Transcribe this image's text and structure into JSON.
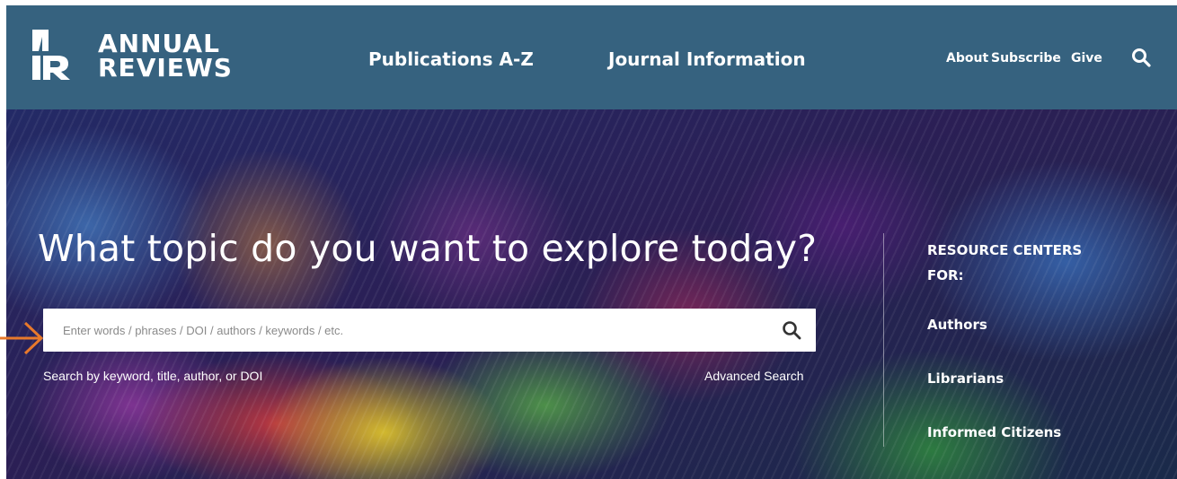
{
  "header": {
    "logo_line1": "ANNUAL",
    "logo_line2": "REVIEWS",
    "nav": {
      "publications": "Publications A-Z",
      "journal_info": "Journal Information",
      "about": "About",
      "subscribe": "Subscribe",
      "give": "Give"
    },
    "search_icon": "search-icon"
  },
  "hero": {
    "headline": "What topic do you want to explore today?",
    "search": {
      "placeholder": "Enter words / phrases / DOI / authors / keywords / etc.",
      "value": "",
      "icon": "search-icon"
    },
    "hint": "Search by keyword, title, author, or DOI",
    "advanced_link": "Advanced Search"
  },
  "resource_centers": {
    "title": "RESOURCE CENTERS FOR:",
    "links": [
      "Authors",
      "Librarians",
      "Informed Citizens"
    ]
  },
  "annotation": {
    "icon": "arrow-right-icon",
    "color": "#e8792b"
  },
  "colors": {
    "header_bg": "#36627f",
    "text": "#ffffff"
  }
}
